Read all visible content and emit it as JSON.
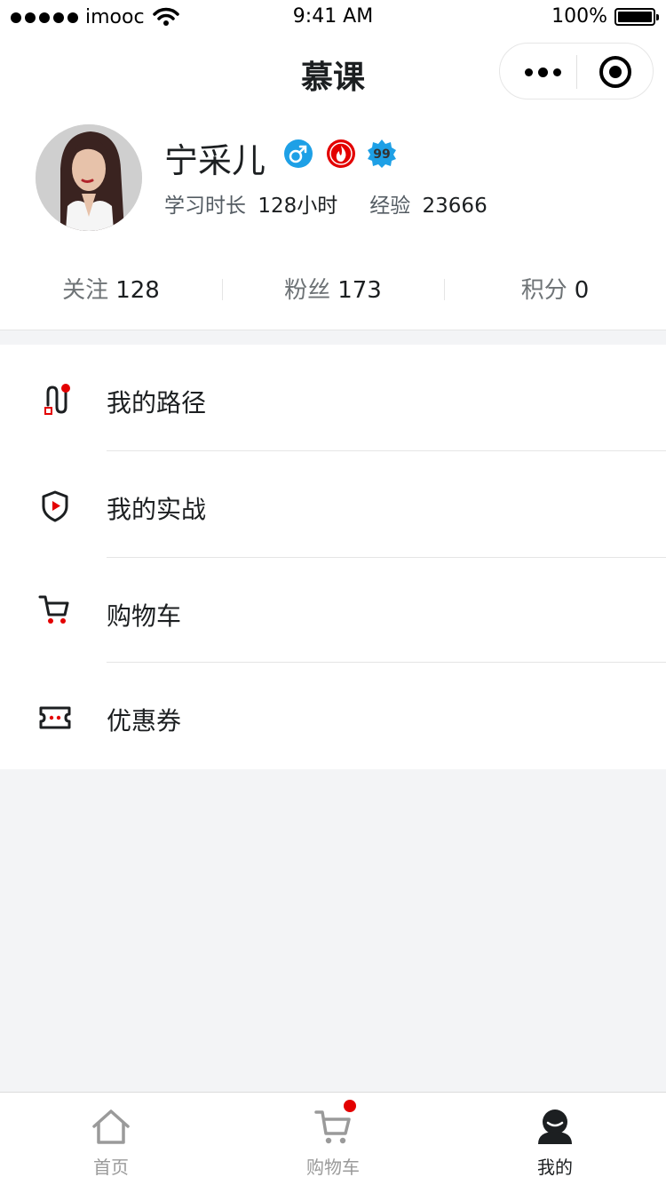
{
  "status_bar": {
    "carrier": "imooc",
    "time": "9:41 AM",
    "battery": "100%"
  },
  "nav": {
    "title": "慕课"
  },
  "profile": {
    "name": "宁采儿",
    "badges": [
      "male-icon",
      "fire-icon",
      "quote-badge-icon"
    ],
    "study_label": "学习时长",
    "study_value": "128小时",
    "exp_label": "经验",
    "exp_value": "23666",
    "counts": [
      {
        "label": "关注",
        "value": "128"
      },
      {
        "label": "粉丝",
        "value": "173"
      },
      {
        "label": "积分",
        "value": "0"
      }
    ]
  },
  "menu": {
    "items": [
      {
        "label": "我的路径",
        "icon": "path-icon"
      },
      {
        "label": "我的实战",
        "icon": "shield-play-icon"
      },
      {
        "label": "购物车",
        "icon": "cart-icon"
      },
      {
        "label": "优惠券",
        "icon": "coupon-icon"
      }
    ]
  },
  "tab_bar": {
    "tabs": [
      {
        "label": "首页",
        "icon": "home-icon",
        "active": false
      },
      {
        "label": "购物车",
        "icon": "cart-icon",
        "active": false,
        "dot": true
      },
      {
        "label": "我的",
        "icon": "user-icon",
        "active": true
      }
    ]
  },
  "colors": {
    "accent_red": "#e30000",
    "text_primary": "#1c1f21",
    "text_secondary": "#545c63",
    "background": "#f3f4f6",
    "male_badge": "#1ea0e6"
  }
}
